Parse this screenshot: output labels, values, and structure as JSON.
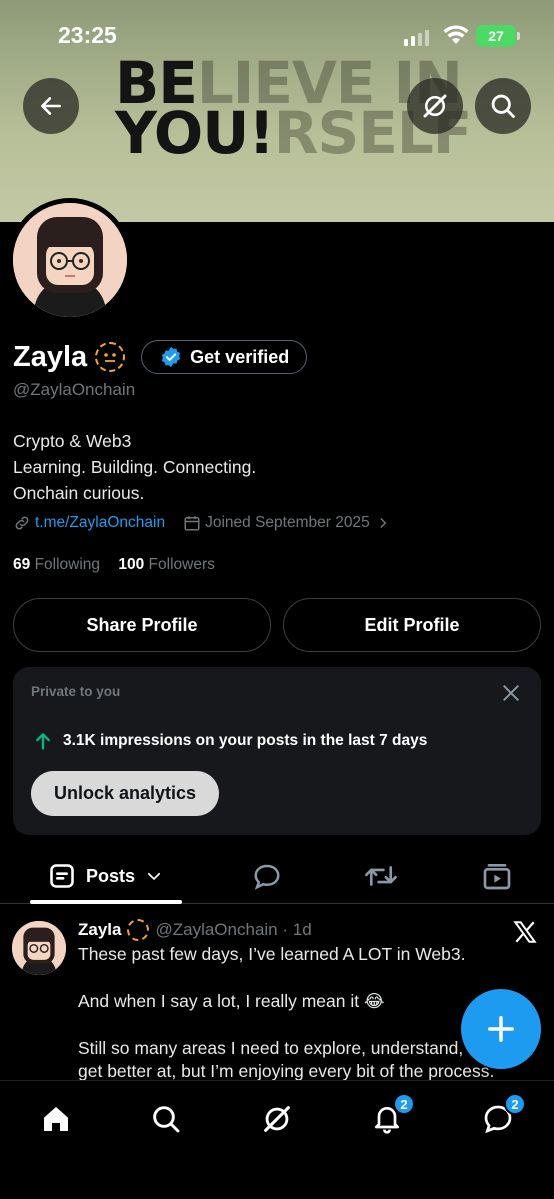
{
  "status_bar": {
    "time": "23:25",
    "battery": "27"
  },
  "banner": {
    "line1_bold": "BE",
    "line1_faded": "LIEVE IN",
    "line2_bold": "YOU!",
    "line2_faded": "RSELF"
  },
  "profile": {
    "display_name": "Zayla",
    "get_verified_label": "Get verified",
    "handle": "@ZaylaOnchain",
    "bio": [
      "Crypto & Web3",
      "Learning. Building. Connecting.",
      "Onchain curious."
    ],
    "link": "t.me/ZaylaOnchain",
    "joined": "Joined September 2025",
    "following_count": "69",
    "following_label": "Following",
    "followers_count": "100",
    "followers_label": "Followers"
  },
  "actions": {
    "share_label": "Share Profile",
    "edit_label": "Edit Profile"
  },
  "analytics_card": {
    "private_label": "Private to you",
    "impressions_text": "3.1K impressions on your posts in the last 7 days",
    "unlock_label": "Unlock analytics"
  },
  "tabs": {
    "posts_label": "Posts"
  },
  "post": {
    "name": "Zayla",
    "handle_time": "@ZaylaOnchain · 1d",
    "lines": [
      "These past few days, I’ve learned A LOT in Web3.",
      "And when I say a lot, I really mean it 😂",
      "Still so many areas I need to explore, understand, and",
      "get better at, but I’m enjoying every bit of the process."
    ]
  },
  "bottom_nav": {
    "notifications_badge": "2",
    "messages_badge": "2"
  },
  "colors": {
    "accent": "#1d9bf0",
    "background": "#000000",
    "muted": "#71767b",
    "up_arrow": "#00ba7c"
  }
}
